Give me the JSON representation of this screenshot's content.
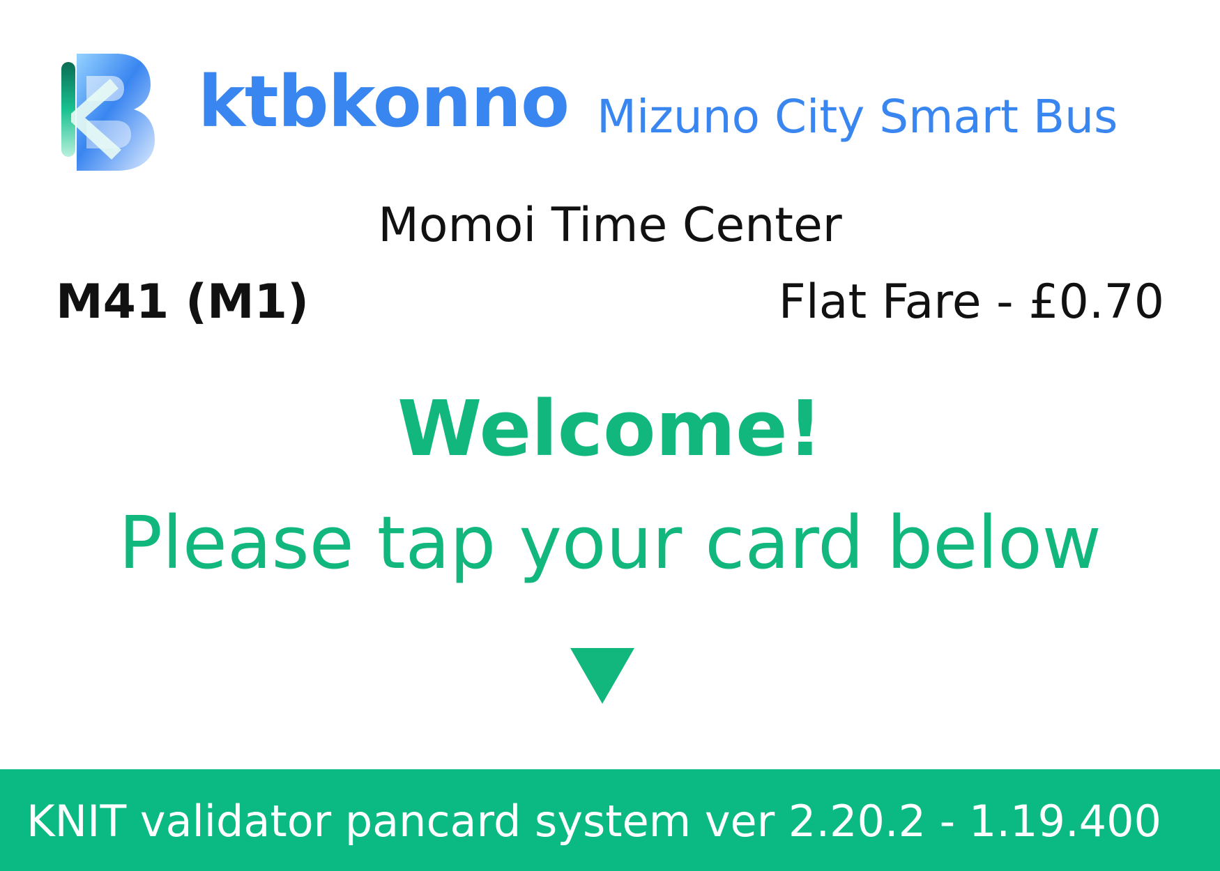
{
  "header": {
    "logo_icon": "ktbkonno-b-logo-icon",
    "brand_name": "ktbkonno",
    "brand_subtitle": "Mizuno City Smart Bus",
    "brand_color": "#3a86f1"
  },
  "trip": {
    "stop_name": "Momoi Time Center",
    "route": "M41 (M1)",
    "fare": "Flat Fare - £0.70"
  },
  "prompt": {
    "welcome": "Welcome!",
    "instruction": "Please tap your card below",
    "arrow_icon": "down-triangle-icon",
    "accent_color": "#12b77e"
  },
  "footer": {
    "version_text": "KNIT validator pancard system ver 2.20.2 - 1.19.400",
    "background_color": "#0bba82"
  }
}
